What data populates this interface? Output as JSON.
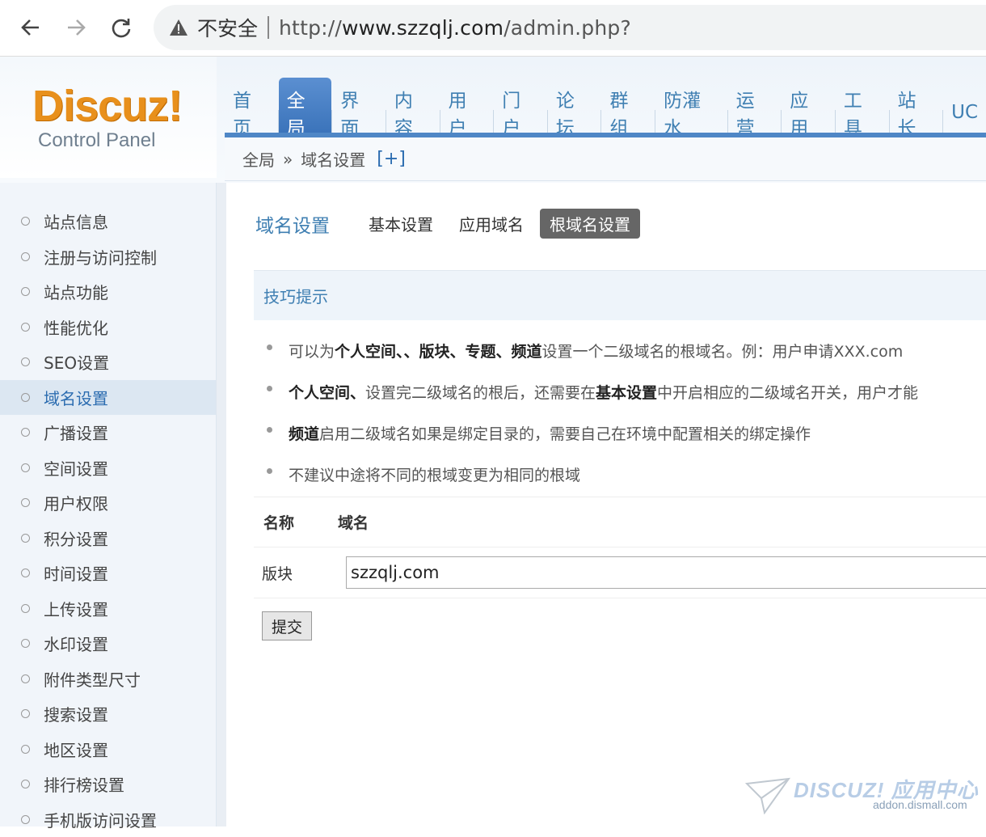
{
  "browser": {
    "security_label": "不安全",
    "url_prefix": "http://",
    "url_domain": "www.szzqlj.com",
    "url_path": "/admin.php?"
  },
  "logo": {
    "brand": "Discuz!",
    "subtitle": "Control Panel"
  },
  "topnav": [
    "首页",
    "全局",
    "界面",
    "内容",
    "用户",
    "门户",
    "论坛",
    "群组",
    "防灌水",
    "运营",
    "应用",
    "工具",
    "站长",
    "UC"
  ],
  "topnav_active": "全局",
  "breadcrumb": {
    "root": "全局",
    "arrow": "»",
    "current": "域名设置",
    "plus": "[+]"
  },
  "sidebar": {
    "items": [
      "站点信息",
      "注册与访问控制",
      "站点功能",
      "性能优化",
      "SEO设置",
      "域名设置",
      "广播设置",
      "空间设置",
      "用户权限",
      "积分设置",
      "时间设置",
      "上传设置",
      "水印设置",
      "附件类型尺寸",
      "搜索设置",
      "地区设置",
      "排行榜设置",
      "手机版访问设置"
    ],
    "active": "域名设置"
  },
  "subnav": {
    "title": "域名设置",
    "tabs": [
      "基本设置",
      "应用域名",
      "根域名设置"
    ],
    "active": "根域名设置"
  },
  "tips": {
    "heading": "技巧提示",
    "items": [
      {
        "pre": "可以为",
        "bold": "个人空间、、版块、专题、频道",
        "post": "设置一个二级域名的根域名。例：用户申请XXX.com"
      },
      {
        "pre": "",
        "bold": "个人空间、",
        "post": "设置完二级域名的根后，还需要在",
        "bold2": "基本设置",
        "post2": "中开启相应的二级域名开关，用户才能"
      },
      {
        "pre": "",
        "bold": "频道",
        "post": "启用二级域名如果是绑定目录的，需要自己在环境中配置相关的绑定操作"
      },
      {
        "pre": "不建议中途将不同的根域变更为相同的根域",
        "bold": "",
        "post": ""
      }
    ]
  },
  "table": {
    "col_name": "名称",
    "col_domain": "域名",
    "rows": [
      {
        "name": "版块",
        "domain": "szzqlj.com"
      }
    ]
  },
  "submit_label": "提交",
  "watermark": {
    "brand": "DISCUZ! 应用中心",
    "url": "addon.dismall.com"
  }
}
